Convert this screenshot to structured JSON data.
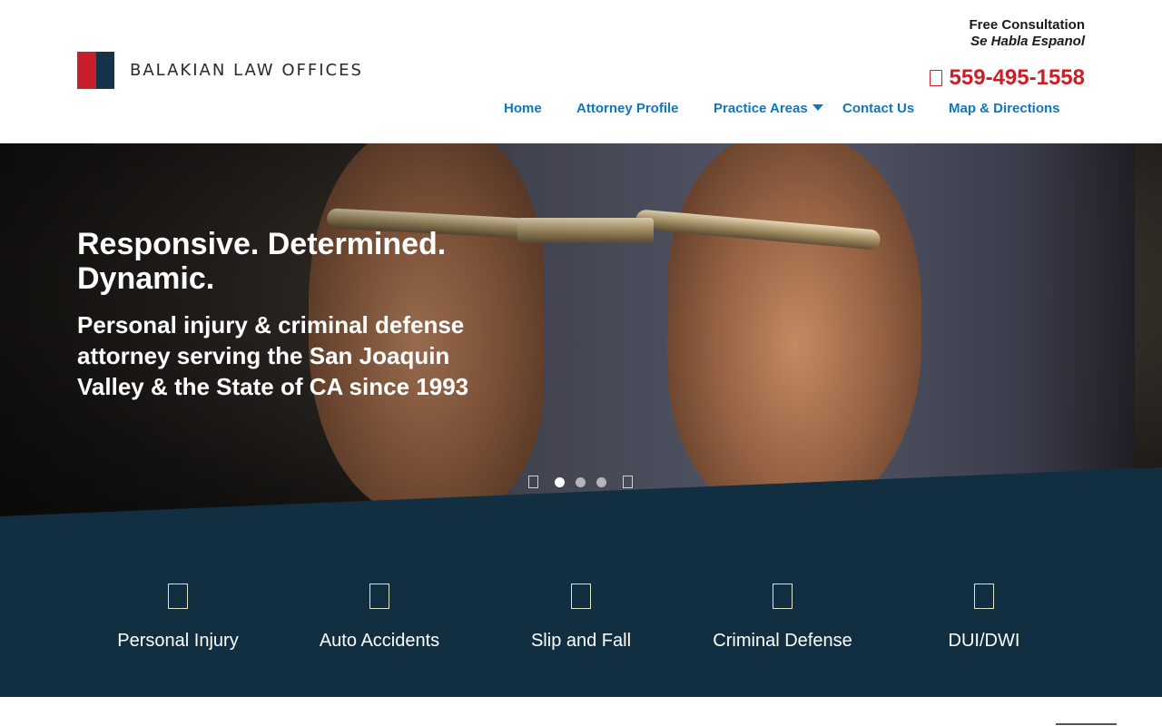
{
  "brand": {
    "name": "Balakian Law Offices",
    "accent_red": "#c8202a",
    "navy": "#112f40",
    "link_blue": "#1177bb"
  },
  "header": {
    "consultation": "Free Consultation",
    "spanish": "Se Habla Espanol",
    "phone": "559-495-1558",
    "phone_icon": "phone-icon"
  },
  "nav": {
    "items": [
      {
        "label": "Home"
      },
      {
        "label": "Attorney Profile"
      },
      {
        "label": "Practice Areas",
        "has_dropdown": true
      },
      {
        "label": "Contact Us"
      },
      {
        "label": "Map & Directions"
      }
    ]
  },
  "hero": {
    "title": "Responsive. Determined. Dynamic.",
    "subtitle": "Personal injury & criminal defense attorney serving the San Joaquin Valley & the State of CA since 1993",
    "slides_count": 3,
    "active_slide": 1
  },
  "practice_areas": [
    {
      "label": "Personal Injury",
      "icon": "personal-injury-icon"
    },
    {
      "label": "Auto Accidents",
      "icon": "auto-accidents-icon"
    },
    {
      "label": "Slip and Fall",
      "icon": "slip-and-fall-icon"
    },
    {
      "label": "Criminal Defense",
      "icon": "criminal-defense-icon"
    },
    {
      "label": "DUI/DWI",
      "icon": "dui-dwi-icon"
    }
  ]
}
